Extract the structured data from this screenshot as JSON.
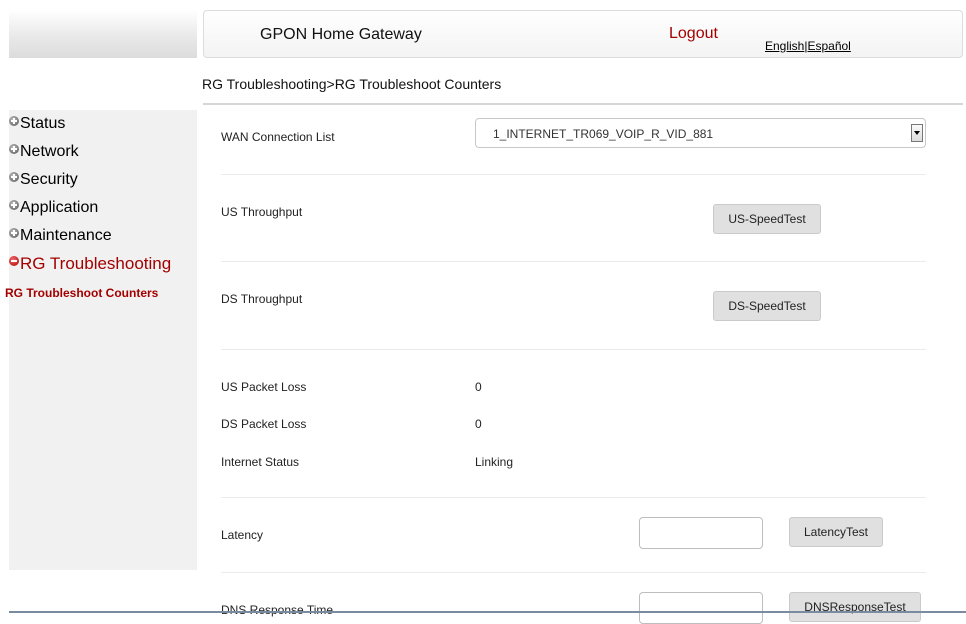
{
  "header": {
    "title": "GPON Home Gateway",
    "logout": "Logout",
    "lang_en": "English",
    "lang_sep": "|",
    "lang_es": "Español"
  },
  "breadcrumb": "RG Troubleshooting>RG Troubleshoot Counters",
  "sidebar": {
    "items": [
      {
        "label": "Status",
        "icon": "plus-icon"
      },
      {
        "label": "Network",
        "icon": "plus-icon"
      },
      {
        "label": "Security",
        "icon": "plus-icon"
      },
      {
        "label": "Application",
        "icon": "plus-icon"
      },
      {
        "label": "Maintenance",
        "icon": "plus-icon"
      },
      {
        "label": "RG Troubleshooting",
        "icon": "minus-icon",
        "active": true
      }
    ],
    "sub_item": "RG Troubleshoot Counters"
  },
  "content": {
    "wan_label": "WAN Connection List",
    "wan_selected": "1_INTERNET_TR069_VOIP_R_VID_881",
    "us_throughput_label": "US Throughput",
    "us_button": "US-SpeedTest",
    "ds_throughput_label": "DS Throughput",
    "ds_button": "DS-SpeedTest",
    "us_packet_loss_label": "US Packet Loss",
    "us_packet_loss_value": "0",
    "ds_packet_loss_label": "DS Packet Loss",
    "ds_packet_loss_value": "0",
    "internet_status_label": "Internet Status",
    "internet_status_value": "Linking",
    "latency_label": "Latency",
    "latency_value": "",
    "latency_button": "LatencyTest",
    "dns_label": "DNS Response Time",
    "dns_value": "",
    "dns_button": "DNSResponseTest"
  },
  "colors": {
    "accent_red": "#a30000",
    "sidebar_bg": "#f1f1f1",
    "button_bg": "#e0e0e0"
  }
}
